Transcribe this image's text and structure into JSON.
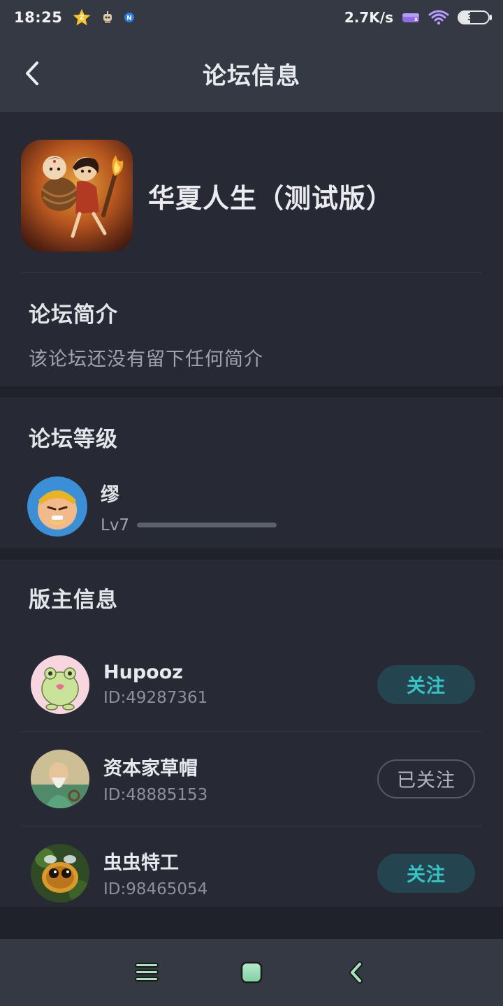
{
  "statusbar": {
    "time": "18:25",
    "net_speed": "2.7K/s",
    "battery": "37",
    "battery_level": 0.37
  },
  "header": {
    "title": "论坛信息"
  },
  "forum": {
    "name": "华夏人生（测试版）"
  },
  "intro": {
    "title": "论坛简介",
    "text": "该论坛还没有留下任何简介"
  },
  "level": {
    "title": "论坛等级",
    "user_name": "缪",
    "level_label": "Lv7",
    "progress": 0
  },
  "moderators": {
    "title": "版主信息",
    "items": [
      {
        "name": "Hupooz",
        "id": "ID:49287361",
        "follow_label": "关注",
        "following": false
      },
      {
        "name": "资本家草帽",
        "id": "ID:48885153",
        "follow_label": "已关注",
        "following": true
      },
      {
        "name": "虫虫特工",
        "id": "ID:98465054",
        "follow_label": "关注",
        "following": false
      }
    ]
  },
  "colors": {
    "background": "#1f222b",
    "card": "#272a35",
    "bar": "#353944",
    "accent": "#34c4c6"
  },
  "icons": {
    "back": "chevron-left-icon",
    "menu": "menu-icon",
    "home": "home-icon",
    "nav_back": "back-icon"
  }
}
